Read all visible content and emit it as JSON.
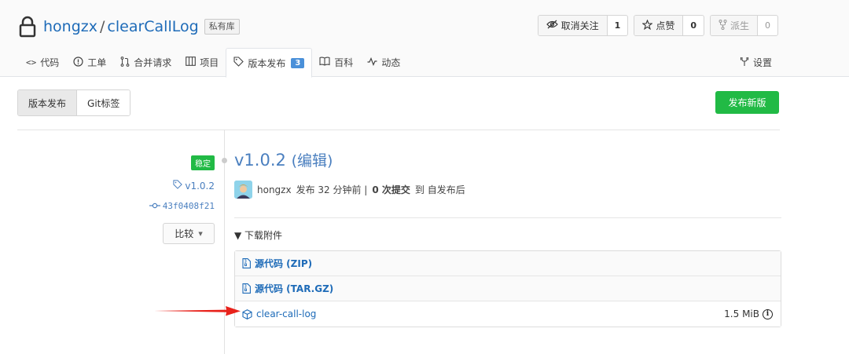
{
  "repo": {
    "owner": "hongzx",
    "separator": "/",
    "name": "clearCallLog",
    "visibility_badge": "私有库"
  },
  "actions": {
    "watch": {
      "label": "取消关注",
      "count": "1"
    },
    "star": {
      "label": "点赞",
      "count": "0"
    },
    "fork": {
      "label": "派生",
      "count": "0"
    }
  },
  "tabs": [
    {
      "label": "代码",
      "icon": "code-icon"
    },
    {
      "label": "工单",
      "icon": "issue-icon"
    },
    {
      "label": "合并请求",
      "icon": "pull-request-icon"
    },
    {
      "label": "项目",
      "icon": "project-icon"
    },
    {
      "label": "版本发布",
      "icon": "tag-icon",
      "count": "3",
      "active": true
    },
    {
      "label": "百科",
      "icon": "book-icon"
    },
    {
      "label": "动态",
      "icon": "pulse-icon"
    }
  ],
  "settings_tab": "设置",
  "subnav": {
    "releases": "版本发布",
    "tags": "Git标签",
    "new_release": "发布新版"
  },
  "release": {
    "badge": "稳定",
    "tag": "v1.0.2",
    "commit": "43f0408f21",
    "compare": "比较",
    "title": "v1.0.2",
    "edit": "(编辑)",
    "author": "hongzx",
    "published": "发布 32 分钟前 |",
    "commits_count": "0 次提交",
    "since": "到 自发布后"
  },
  "downloads": {
    "toggle": "▼ 下载附件",
    "assets": [
      {
        "name": "源代码 (ZIP)",
        "icon": "zip-icon",
        "size": ""
      },
      {
        "name": "源代码 (TAR.GZ)",
        "icon": "zip-icon",
        "size": ""
      },
      {
        "name": "clear-call-log",
        "icon": "package-icon",
        "size": "1.5 MiB"
      }
    ]
  },
  "colors": {
    "link": "#1e6bb8",
    "green": "#21ba45",
    "badge_blue": "#4a90d9",
    "annotation_arrow": "#e8221b"
  }
}
